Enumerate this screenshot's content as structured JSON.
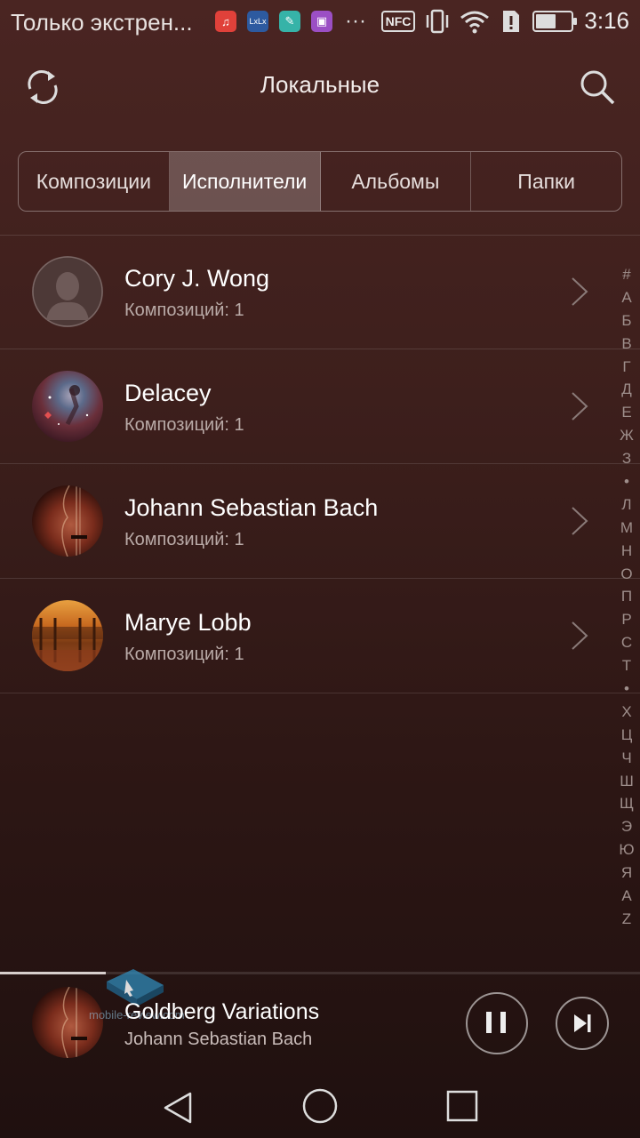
{
  "status_bar": {
    "carrier_text": "Только экстрен...",
    "nfc_label": "NFC",
    "time": "3:16",
    "battery_level": 0.6,
    "notification_icons": [
      "music-app-icon",
      "lxlx-app-icon",
      "notes-app-icon",
      "gallery-app-icon"
    ],
    "notification_more": "···"
  },
  "header": {
    "title": "Локальные"
  },
  "tabs": [
    {
      "label": "Композиции",
      "active": false
    },
    {
      "label": "Исполнители",
      "active": true
    },
    {
      "label": "Альбомы",
      "active": false
    },
    {
      "label": "Папки",
      "active": false
    }
  ],
  "artists": [
    {
      "name": "Cory J. Wong",
      "subtitle": "Композиций: 1",
      "avatar": "default-person"
    },
    {
      "name": "Delacey",
      "subtitle": "Композиций: 1",
      "avatar": "nebula"
    },
    {
      "name": "Johann Sebastian Bach",
      "subtitle": "Композиций: 1",
      "avatar": "violin"
    },
    {
      "name": "Marye Lobb",
      "subtitle": "Композиций: 1",
      "avatar": "hall"
    }
  ],
  "alphabet_index": [
    "#",
    "А",
    "Б",
    "В",
    "Г",
    "Д",
    "Е",
    "Ж",
    "З",
    "•",
    "Л",
    "М",
    "Н",
    "О",
    "П",
    "Р",
    "С",
    "Т",
    "•",
    "Х",
    "Ц",
    "Ч",
    "Ш",
    "Щ",
    "Э",
    "Ю",
    "Я",
    "A",
    "Z"
  ],
  "player": {
    "title": "Goldberg Variations",
    "artist": "Johann Sebastian Bach",
    "progress": 0.165,
    "watermark_text": "mobile-review.com"
  },
  "colors": {
    "background_top": "#4a2522",
    "background_bottom": "#1f100f",
    "active_tab": "#6a5452"
  }
}
